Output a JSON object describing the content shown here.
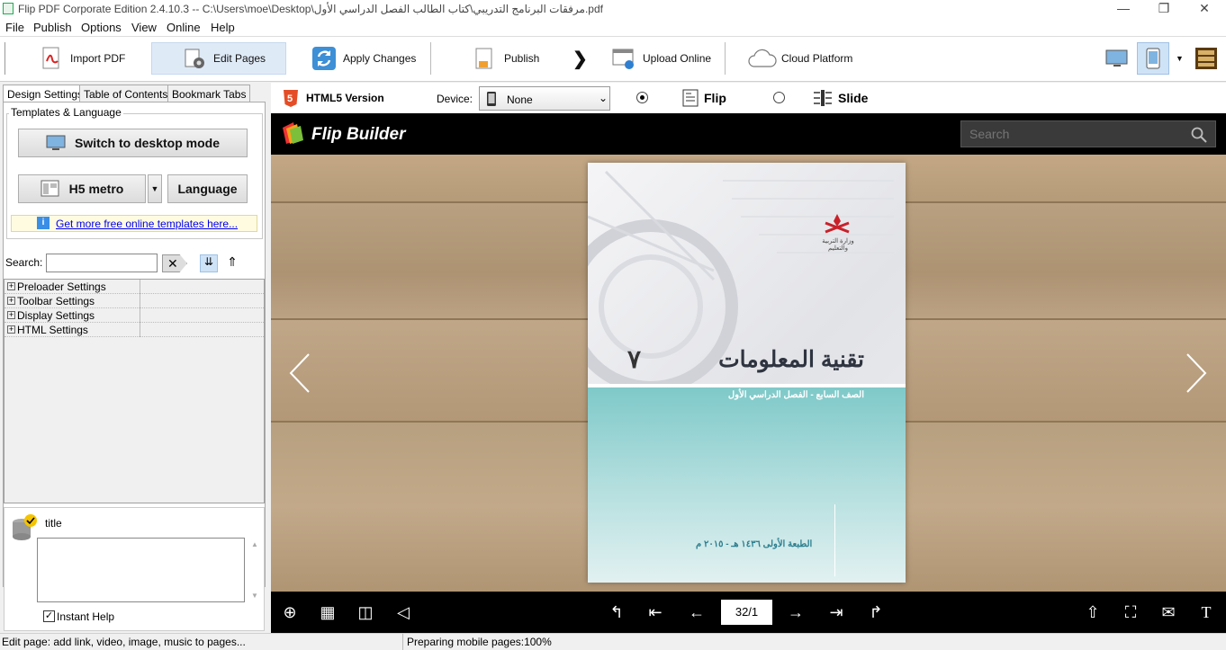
{
  "window": {
    "title": "Flip PDF Corporate Edition 2.4.10.3 -- C:\\Users\\moe\\Desktop\\مرفقات البرنامج التدريبي\\كتاب الطالب الفصل الدراسي الأول.pdf",
    "minimize": "—",
    "maximize": "❐",
    "close": "✕"
  },
  "menu": {
    "file": "File",
    "publish": "Publish",
    "options": "Options",
    "view": "View",
    "online": "Online",
    "help": "Help"
  },
  "toolbar": {
    "import_pdf": "Import PDF",
    "edit_pages": "Edit Pages",
    "apply_changes": "Apply Changes",
    "publish": "Publish",
    "upload_online": "Upload Online",
    "cloud_platform": "Cloud Platform"
  },
  "left": {
    "tabs": [
      "Design Settings",
      "Table of Contents",
      "Bookmark Tabs"
    ],
    "group_title": "Templates & Language",
    "switch_desktop": "Switch to desktop mode",
    "template_name": "H5 metro",
    "language": "Language",
    "more_templates": "Get more free online templates here...",
    "search_label": "Search:",
    "search_value": "",
    "tree": [
      "Preloader Settings",
      "Toolbar Settings",
      "Display Settings",
      "HTML Settings"
    ],
    "help_title": "title",
    "help_text": "",
    "instant_help": "Instant Help"
  },
  "preview": {
    "html5_label": "HTML5 Version",
    "device_label": "Device:",
    "device_value": "None",
    "flip_label": "Flip",
    "slide_label": "Slide",
    "brand": "Flip Builder",
    "search_placeholder": "Search",
    "page_indicator": "32/1"
  },
  "book": {
    "title": "تقنية المعلومات",
    "grade_num": "٧",
    "subtitle": "الصف السابع - الفصل الدراسي الأول",
    "edition": "الطبعة الأولى ١٤٣٦ هـ - ٢٠١٥ م",
    "ministry": "وزارة التربية والتعليم"
  },
  "status": {
    "left": "Edit page: add link, video, image, music to pages...",
    "right": "Preparing mobile pages:100%"
  },
  "colors": {
    "accent": "#0000ee",
    "teal": "#7fc9c9"
  }
}
